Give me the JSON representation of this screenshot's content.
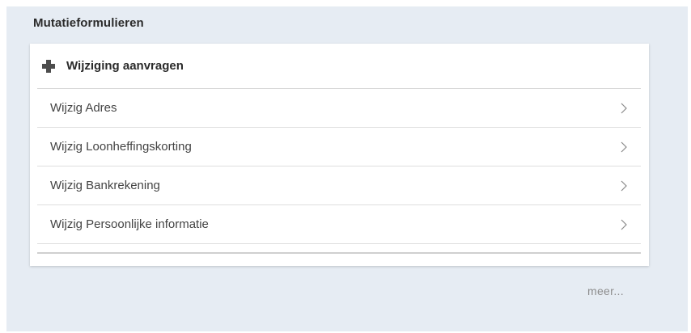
{
  "panel": {
    "title": "Mutatieformulieren"
  },
  "card": {
    "header_icon": "plus-icon",
    "header_label": "Wijziging aanvragen",
    "items": [
      {
        "label": "Wijzig Adres",
        "icon": "chevron-right-icon"
      },
      {
        "label": "Wijzig Loonheffingskorting",
        "icon": "chevron-right-icon"
      },
      {
        "label": "Wijzig Bankrekening",
        "icon": "chevron-right-icon"
      },
      {
        "label": "Wijzig Persoonlijke informatie",
        "icon": "chevron-right-icon"
      }
    ]
  },
  "footer": {
    "more_label": "meer..."
  },
  "colors": {
    "panel_background": "#e6ecf3",
    "card_background": "#ffffff",
    "text_primary": "#2b2b2b",
    "text_item": "#444444",
    "text_muted": "#8c8c8c"
  }
}
